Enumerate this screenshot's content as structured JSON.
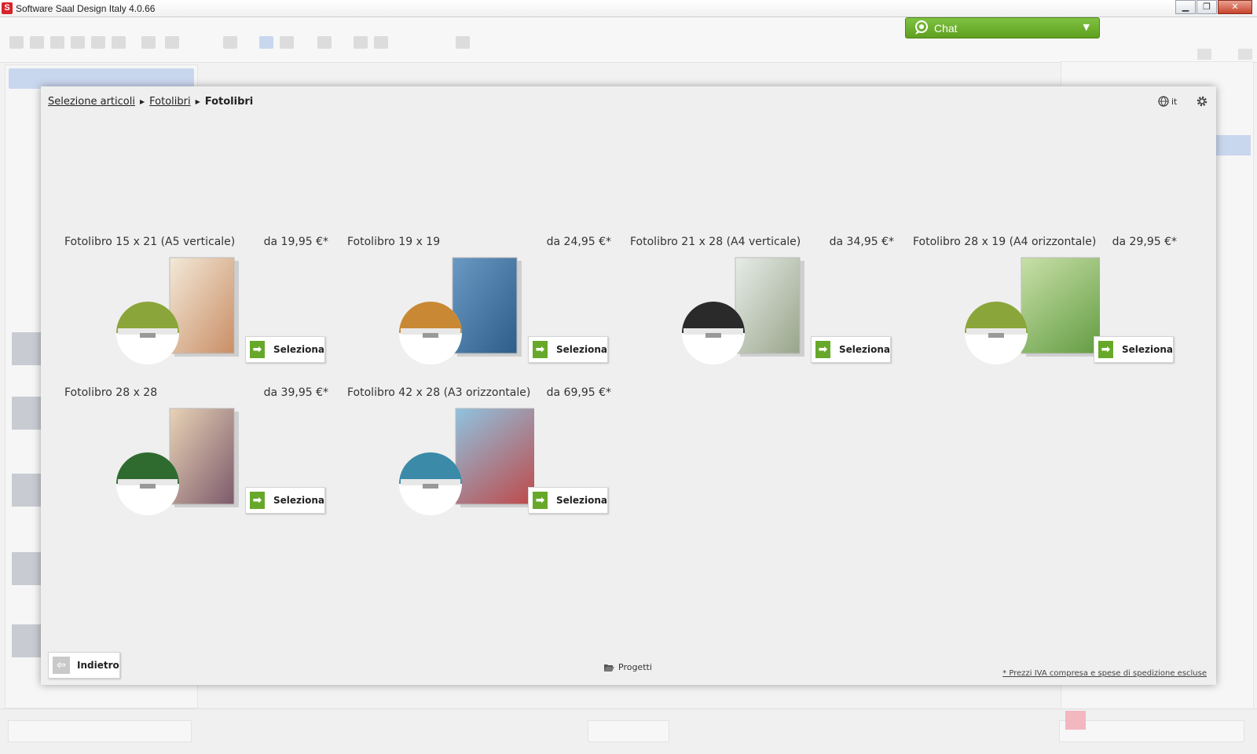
{
  "window": {
    "title": "Software Saal Design Italy 4.0.66",
    "buttons": [
      "▁",
      "❐",
      "✕"
    ]
  },
  "chat": {
    "label": "Chat"
  },
  "breadcrumb": {
    "items": [
      "Selezione articoli",
      "Fotolibri"
    ],
    "current": "Fotolibri"
  },
  "language": "it",
  "products": [
    {
      "title": "Fotolibro 15 x 21 (A5 verticale)",
      "price": "da 19,95 €*",
      "button": "Seleziona",
      "accent": "#8aa53a",
      "cover": [
        "#f3e9d8",
        "#c98e66"
      ]
    },
    {
      "title": "Fotolibro 19 x 19",
      "price": "da 24,95 €*",
      "button": "Seleziona",
      "accent": "#c98934",
      "cover": [
        "#6a9ac4",
        "#2d5d88"
      ]
    },
    {
      "title": "Fotolibro 21 x 28 (A4 verticale)",
      "price": "da 34,95 €*",
      "button": "Seleziona",
      "accent": "#2a2a2a",
      "cover": [
        "#e7ece8",
        "#98a58a"
      ]
    },
    {
      "title": "Fotolibro 28 x 19 (A4 orizzontale)",
      "price": "da 29,95 €*",
      "button": "Seleziona",
      "accent": "#8aa53a",
      "cover": [
        "#c8e0a8",
        "#4f8f2e"
      ]
    },
    {
      "title": "Fotolibro 28 x 28",
      "price": "da 39,95 €*",
      "button": "Seleziona",
      "accent": "#2f6b2f",
      "cover": [
        "#e8d3b6",
        "#7d5a6b"
      ]
    },
    {
      "title": "Fotolibro 42 x 28 (A3 orizzontale)",
      "price": "da 69,95 €*",
      "button": "Seleziona",
      "accent": "#3a8aa8",
      "cover": [
        "#8fc3e0",
        "#c8302a"
      ]
    }
  ],
  "footer": {
    "back": "Indietro",
    "projects": "Progetti",
    "note": "* Prezzi IVA compresa e spese di spedizione escluse"
  },
  "colors": {
    "accent_green": "#67a82a",
    "chat_green": "#6cae2b",
    "brand_red": "#d8232a"
  }
}
